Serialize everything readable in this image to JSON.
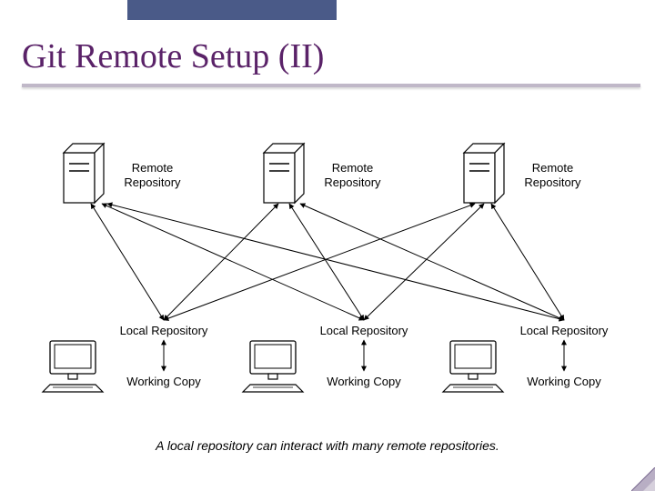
{
  "title": "Git Remote Setup (II)",
  "remote_label_line1": "Remote",
  "remote_label_line2": "Repository",
  "local_label": "Local Repository",
  "working_label": "Working Copy",
  "caption": "A local repository can interact with many remote repositories.",
  "chart_data": {
    "type": "diagram",
    "title": "Git Remote Setup (II)",
    "nodes": [
      {
        "id": "remote1",
        "kind": "server",
        "label": "Remote Repository"
      },
      {
        "id": "remote2",
        "kind": "server",
        "label": "Remote Repository"
      },
      {
        "id": "remote3",
        "kind": "server",
        "label": "Remote Repository"
      },
      {
        "id": "local1",
        "kind": "local-repo",
        "label": "Local Repository"
      },
      {
        "id": "local2",
        "kind": "local-repo",
        "label": "Local Repository"
      },
      {
        "id": "local3",
        "kind": "local-repo",
        "label": "Local Repository"
      },
      {
        "id": "wc1",
        "kind": "working-copy",
        "label": "Working Copy"
      },
      {
        "id": "wc2",
        "kind": "working-copy",
        "label": "Working Copy"
      },
      {
        "id": "wc3",
        "kind": "working-copy",
        "label": "Working Copy"
      }
    ],
    "edges": [
      {
        "from": "remote1",
        "to": "local1",
        "bidirectional": true
      },
      {
        "from": "remote1",
        "to": "local2",
        "bidirectional": true
      },
      {
        "from": "remote1",
        "to": "local3",
        "bidirectional": true
      },
      {
        "from": "remote2",
        "to": "local1",
        "bidirectional": true
      },
      {
        "from": "remote2",
        "to": "local2",
        "bidirectional": true
      },
      {
        "from": "remote2",
        "to": "local3",
        "bidirectional": true
      },
      {
        "from": "remote3",
        "to": "local1",
        "bidirectional": true
      },
      {
        "from": "remote3",
        "to": "local2",
        "bidirectional": true
      },
      {
        "from": "remote3",
        "to": "local3",
        "bidirectional": true
      },
      {
        "from": "local1",
        "to": "wc1",
        "bidirectional": true
      },
      {
        "from": "local2",
        "to": "wc2",
        "bidirectional": true
      },
      {
        "from": "local3",
        "to": "wc3",
        "bidirectional": true
      }
    ],
    "caption": "A local repository can interact with many remote repositories."
  }
}
